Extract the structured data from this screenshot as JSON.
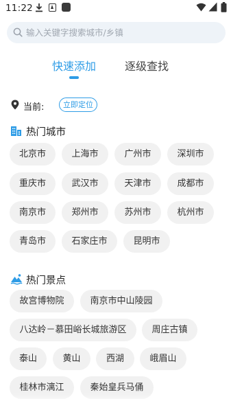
{
  "status_bar": {
    "time": "11:22",
    "icons": [
      "download-icon",
      "a-icon",
      "app-icon",
      "wifi-icon",
      "signal-icon",
      "battery-icon"
    ]
  },
  "search": {
    "placeholder": "输入关键字搜索城市/乡镇"
  },
  "tabs": [
    {
      "label": "快速添加",
      "active": true
    },
    {
      "label": "逐级查找",
      "active": false
    }
  ],
  "current": {
    "label": "当前:",
    "locate_button": "立即定位"
  },
  "hot_cities": {
    "title": "热门城市",
    "items": [
      "北京市",
      "上海市",
      "广州市",
      "深圳市",
      "重庆市",
      "武汉市",
      "天津市",
      "成都市",
      "南京市",
      "郑州市",
      "苏州市",
      "杭州市",
      "青岛市",
      "石家庄市",
      "昆明市"
    ]
  },
  "hot_spots": {
    "title": "热门景点",
    "items": [
      "故宫博物院",
      "南京市中山陵园",
      "八达岭－慕田峪长城旅游区",
      "周庄古镇",
      "泰山",
      "黄山",
      "西湖",
      "峨眉山",
      "桂林市漓江",
      "秦始皇兵马俑"
    ]
  },
  "colors": {
    "accent": "#2e9ce6",
    "chip_bg": "#f1f1f1",
    "search_bg": "#eef3f8"
  }
}
